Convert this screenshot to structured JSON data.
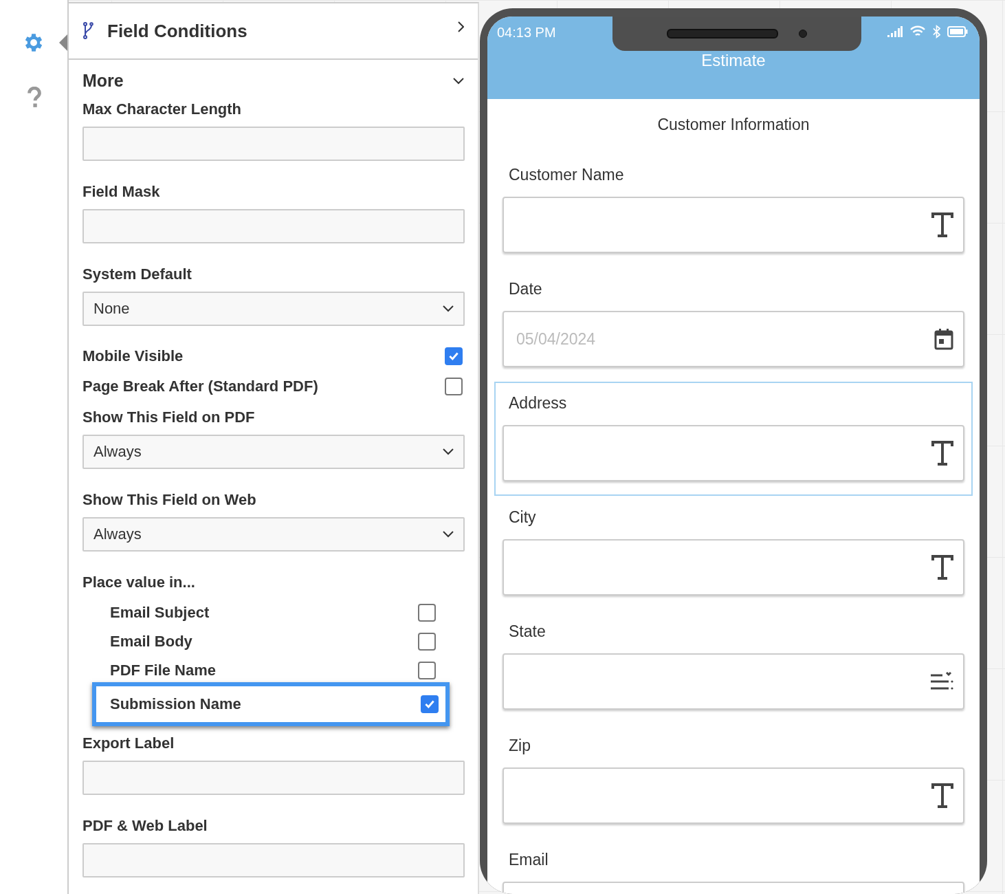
{
  "panel": {
    "field_conditions": {
      "label": "Field Conditions"
    },
    "more": {
      "label": "More",
      "expanded": true
    },
    "settings": [
      {
        "kind": "input",
        "label": "Max Character Length"
      },
      {
        "kind": "input",
        "label": "Field Mask"
      },
      {
        "kind": "select",
        "label": "System Default",
        "value": "None"
      },
      {
        "kind": "checkbox",
        "label": "Mobile Visible",
        "checked": true
      },
      {
        "kind": "checkbox",
        "label": "Page Break After (Standard PDF)",
        "checked": false
      },
      {
        "kind": "select",
        "label": "Show This Field on PDF",
        "value": "Always"
      },
      {
        "kind": "select",
        "label": "Show This Field on Web",
        "value": "Always"
      },
      {
        "kind": "group",
        "label": "Place value in...",
        "options": [
          {
            "label": "Email Subject",
            "checked": false,
            "highlighted": false
          },
          {
            "label": "Email Body",
            "checked": false,
            "highlighted": false
          },
          {
            "label": "PDF File Name",
            "checked": false,
            "highlighted": false
          },
          {
            "label": "Submission Name",
            "checked": true,
            "highlighted": true
          }
        ]
      },
      {
        "kind": "input",
        "label": "Export Label"
      },
      {
        "kind": "input",
        "label": "PDF & Web Label"
      }
    ]
  },
  "phone": {
    "time": "04:13 PM",
    "title": "Estimate",
    "section": "Customer Information",
    "fields": [
      {
        "kind": "text",
        "label": "Customer Name",
        "selected": false
      },
      {
        "kind": "date",
        "label": "Date",
        "placeholder": "05/04/2024",
        "selected": false
      },
      {
        "kind": "text",
        "label": "Address",
        "selected": true
      },
      {
        "kind": "text",
        "label": "City",
        "selected": false
      },
      {
        "kind": "select",
        "label": "State",
        "selected": false
      },
      {
        "kind": "text",
        "label": "Zip",
        "selected": false
      },
      {
        "kind": "text",
        "label": "Email",
        "selected": false
      }
    ]
  }
}
